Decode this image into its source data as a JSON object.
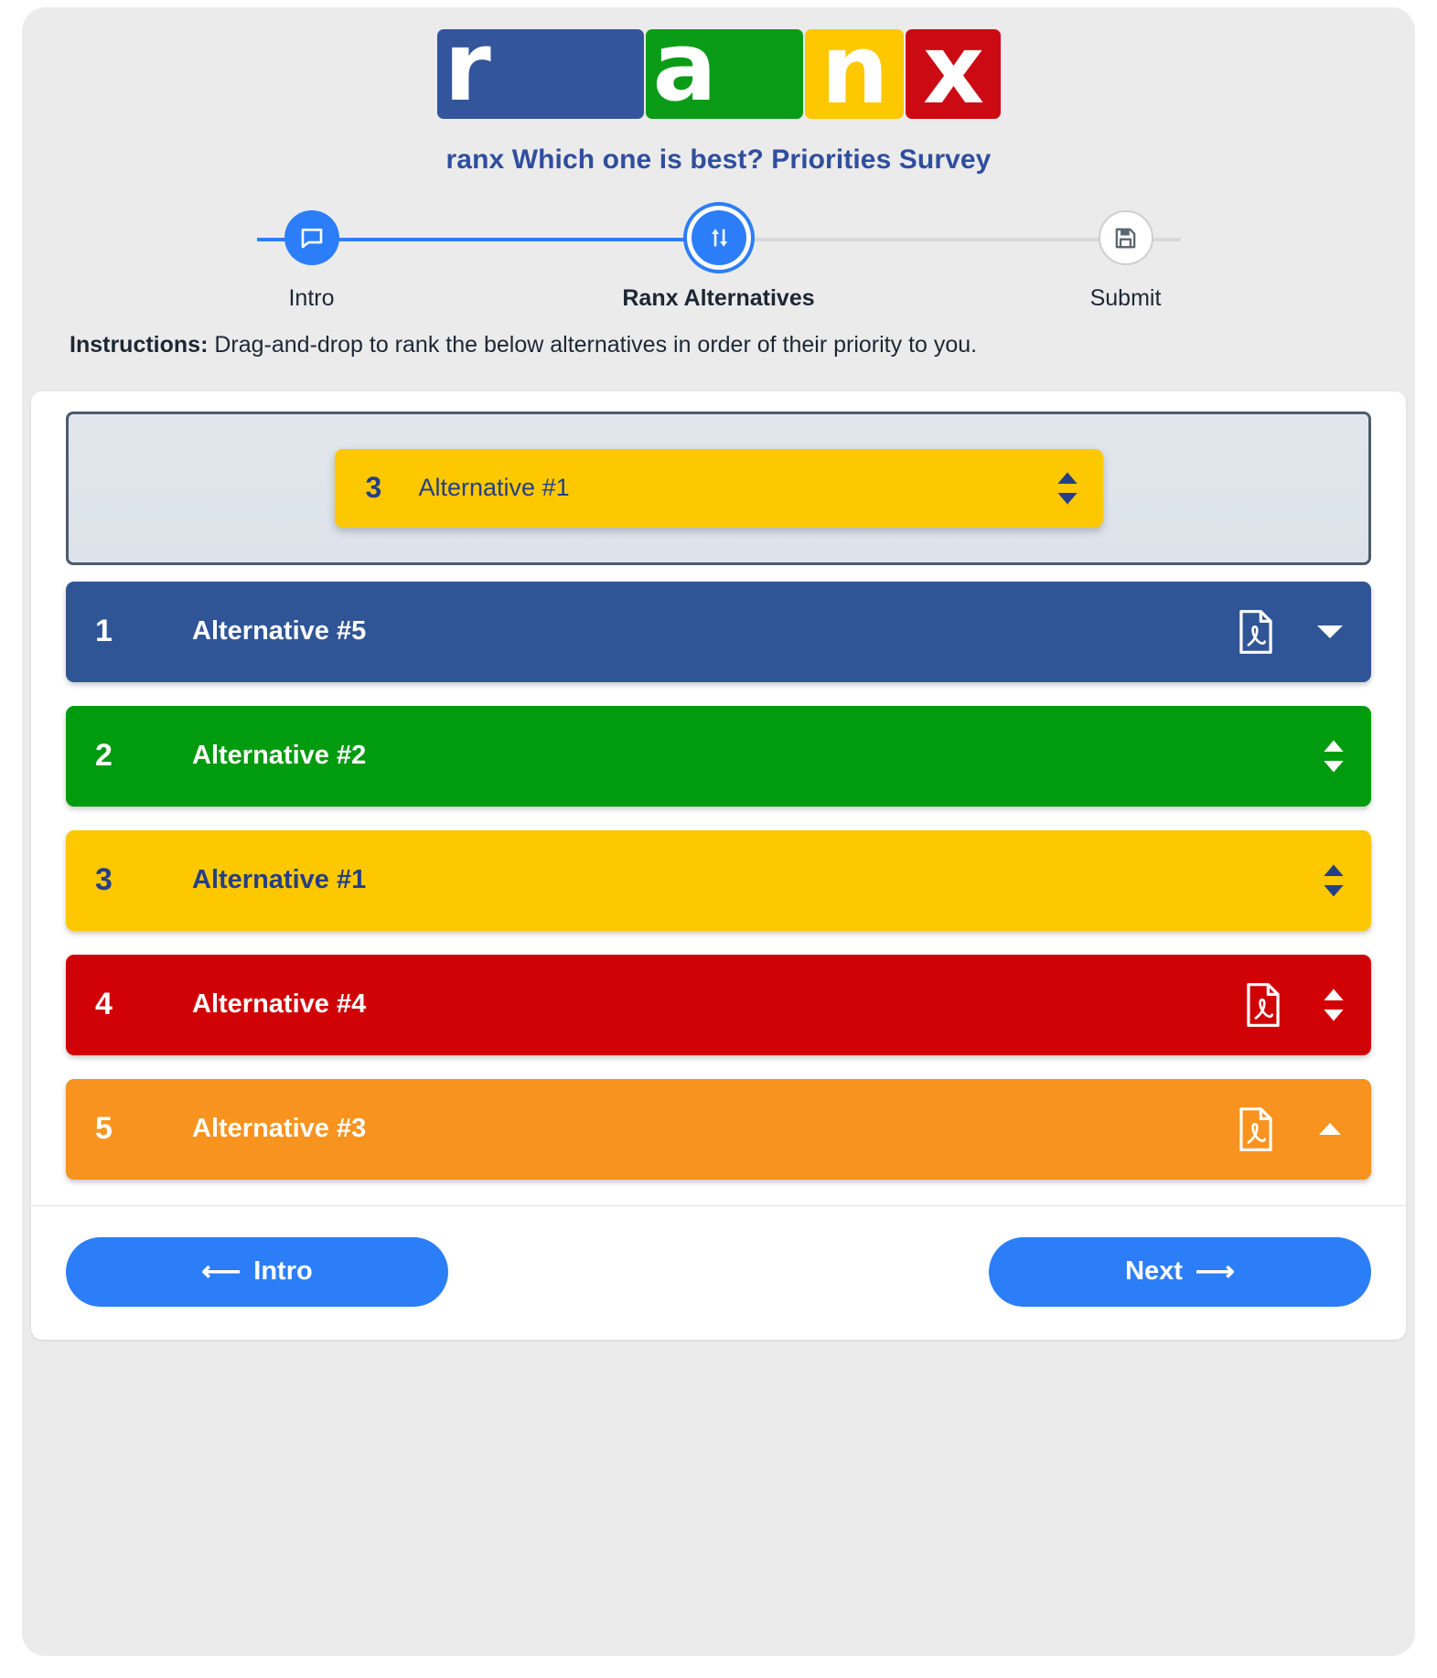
{
  "logo": {
    "tiles": [
      {
        "letter": "r",
        "color": "#33559b",
        "name": "logo-tile-r"
      },
      {
        "letter": "a",
        "color": "#0b9c17",
        "name": "logo-tile-a"
      },
      {
        "letter": "n",
        "color": "#fdc800",
        "name": "logo-tile-n"
      },
      {
        "letter": "x",
        "color": "#cc0a14",
        "name": "logo-tile-x"
      }
    ]
  },
  "header": {
    "title": "ranx Which one is best? Priorities Survey",
    "title_color": "#2f4e9e"
  },
  "stepper": {
    "steps": [
      {
        "label": "Intro",
        "icon": "comment-icon",
        "state": "done"
      },
      {
        "label": "Ranx Alternatives",
        "icon": "sort-updown-icon",
        "state": "active"
      },
      {
        "label": "Submit",
        "icon": "floppy-save-icon",
        "state": "todo"
      }
    ],
    "accent": "#2c7ef8"
  },
  "instructions": {
    "label": "Instructions:",
    "text": "Drag-and-drop to rank the below alternatives in order of their priority to you."
  },
  "dropzone": {
    "dragging_item": {
      "rank": "3",
      "label": "Alternative #1",
      "color": "#fdc800",
      "text_color": "#243f86",
      "icon": "sort-updown-icon"
    }
  },
  "ranking": {
    "rows": [
      {
        "rank": "1",
        "label": "Alternative #5",
        "color": "#2f5597",
        "has_pdf": true,
        "trailing": "caret-down-icon"
      },
      {
        "rank": "2",
        "label": "Alternative #2",
        "color": "#019b10",
        "has_pdf": false,
        "trailing": "sort-updown-icon"
      },
      {
        "rank": "3",
        "label": "Alternative #1",
        "color": "#fdc800",
        "has_pdf": false,
        "trailing": "sort-updown-icon",
        "text_color": "#243f86"
      },
      {
        "rank": "4",
        "label": "Alternative #4",
        "color": "#d10206",
        "has_pdf": true,
        "trailing": "sort-updown-icon"
      },
      {
        "rank": "5",
        "label": "Alternative #3",
        "color": "#f7931e",
        "has_pdf": true,
        "trailing": "caret-up-icon"
      }
    ]
  },
  "footer": {
    "back_label": "Intro",
    "back_icon": "arrow-left-icon",
    "next_label": "Next",
    "next_icon": "arrow-right-icon",
    "button_color": "#2c7ef8"
  }
}
